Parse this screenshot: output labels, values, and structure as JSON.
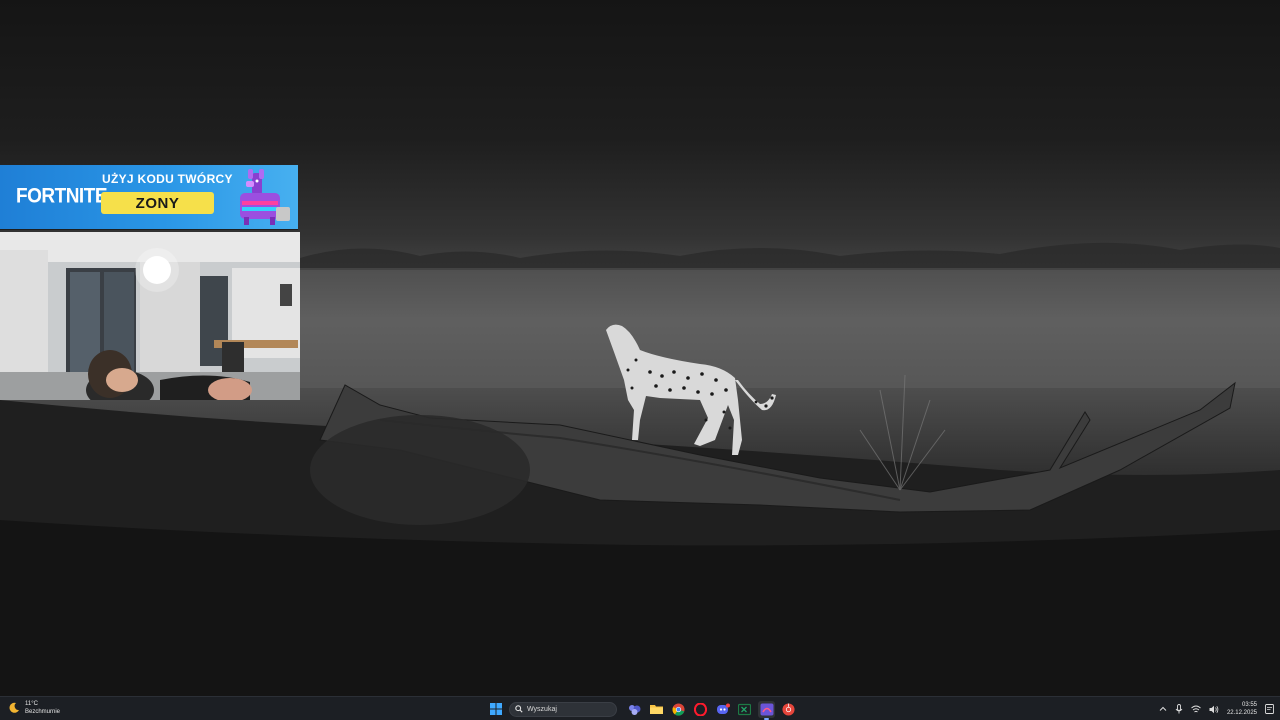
{
  "overlay": {
    "banner": {
      "logo_text": "FORTNITE",
      "line1": "UŻYJ KODU TWÓRCY",
      "code": "ZONY",
      "accent_color": "#2a96e6",
      "code_bg_color": "#f6e04a"
    }
  },
  "taskbar": {
    "weather": {
      "temp": "11°C",
      "condition": "Bezchmurnie",
      "icon": "moon-icon"
    },
    "search": {
      "placeholder": "Wyszukaj",
      "icon": "search-icon"
    },
    "apps": [
      {
        "name": "start",
        "icon": "windows-logo-icon"
      },
      {
        "name": "teams",
        "icon": "teams-icon"
      },
      {
        "name": "file-explorer",
        "icon": "folder-icon"
      },
      {
        "name": "chrome",
        "icon": "chrome-icon"
      },
      {
        "name": "opera-gx",
        "icon": "opera-icon"
      },
      {
        "name": "discord",
        "icon": "discord-icon"
      },
      {
        "name": "excel",
        "icon": "excel-icon"
      },
      {
        "name": "streaming-app",
        "icon": "stream-app-icon",
        "active": true
      },
      {
        "name": "chrome-alt",
        "icon": "chrome-red-icon"
      }
    ],
    "clock": {
      "time": "03:55",
      "date": "22.12.2025"
    }
  }
}
